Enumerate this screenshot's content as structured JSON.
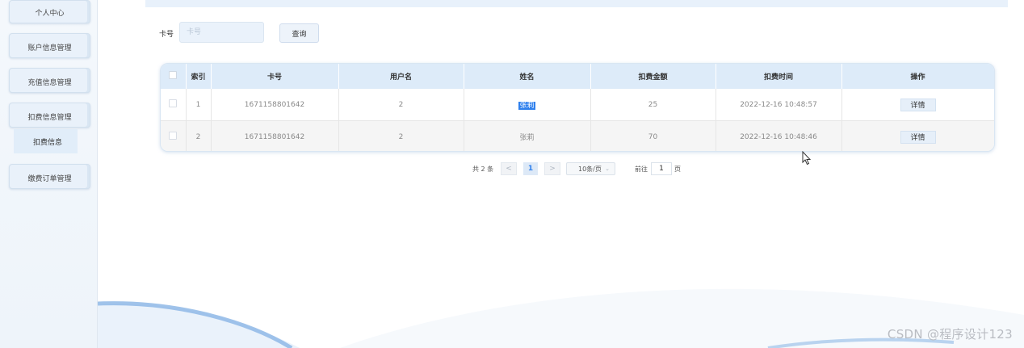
{
  "sidebar": {
    "items": [
      {
        "label": "个人中心"
      },
      {
        "label": "账户信息管理"
      },
      {
        "label": "充值信息管理"
      },
      {
        "label": "扣费信息管理"
      },
      {
        "label": "缴费订单管理"
      }
    ],
    "active_sub": {
      "label": "扣费信息"
    }
  },
  "search": {
    "label": "卡号",
    "placeholder": "卡号",
    "value": "",
    "button_label": "查询"
  },
  "table": {
    "headers": [
      "索引",
      "卡号",
      "用户名",
      "姓名",
      "扣费金额",
      "扣费时间",
      "操作"
    ],
    "rows": [
      {
        "index": "1",
        "card_no": "1671158801642",
        "username": "2",
        "name": "张莉",
        "amount": "25",
        "time": "2022-12-16 10:48:57",
        "action": "详情"
      },
      {
        "index": "2",
        "card_no": "1671158801642",
        "username": "2",
        "name": "张莉",
        "amount": "70",
        "time": "2022-12-16 10:48:46",
        "action": "详情"
      }
    ]
  },
  "pagination": {
    "total_text": "共 2 条",
    "prev_icon": "chevron-left-icon",
    "next_icon": "chevron-right-icon",
    "current_page": "1",
    "page_size": "10条/页",
    "goto_label": "前往",
    "goto_value": "1",
    "goto_unit": "页"
  },
  "watermark": "CSDN @程序设计123",
  "colors": {
    "accent": "#2f80ed",
    "header_bg": "#ddebf9",
    "sidebar_btn": "#e9f1fa"
  }
}
